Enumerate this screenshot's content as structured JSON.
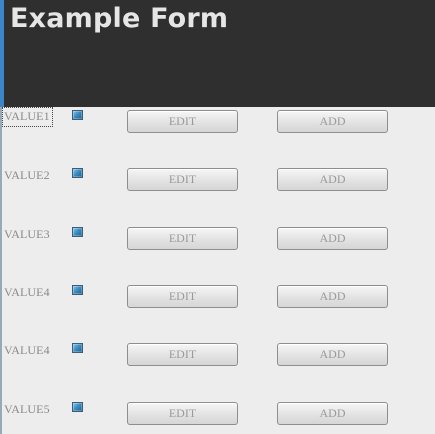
{
  "header": {
    "title": "Example Form"
  },
  "rows": [
    {
      "label": "VALUE1",
      "edit_label": "EDIT",
      "add_label": "ADD"
    },
    {
      "label": "VALUE2",
      "edit_label": "EDIT",
      "add_label": "ADD"
    },
    {
      "label": "VALUE3",
      "edit_label": "EDIT",
      "add_label": "ADD"
    },
    {
      "label": "VALUE4",
      "edit_label": "EDIT",
      "add_label": "ADD"
    },
    {
      "label": "VALUE4",
      "edit_label": "EDIT",
      "add_label": "ADD"
    },
    {
      "label": "VALUE5",
      "edit_label": "EDIT",
      "add_label": "ADD"
    }
  ],
  "icons": {
    "row_icon": "blue-square-icon"
  },
  "colors": {
    "header_background": "#2f2f2f",
    "title_text": "#e6e6e6",
    "page_background": "#ededed",
    "header_accent": "#3a86c8"
  }
}
